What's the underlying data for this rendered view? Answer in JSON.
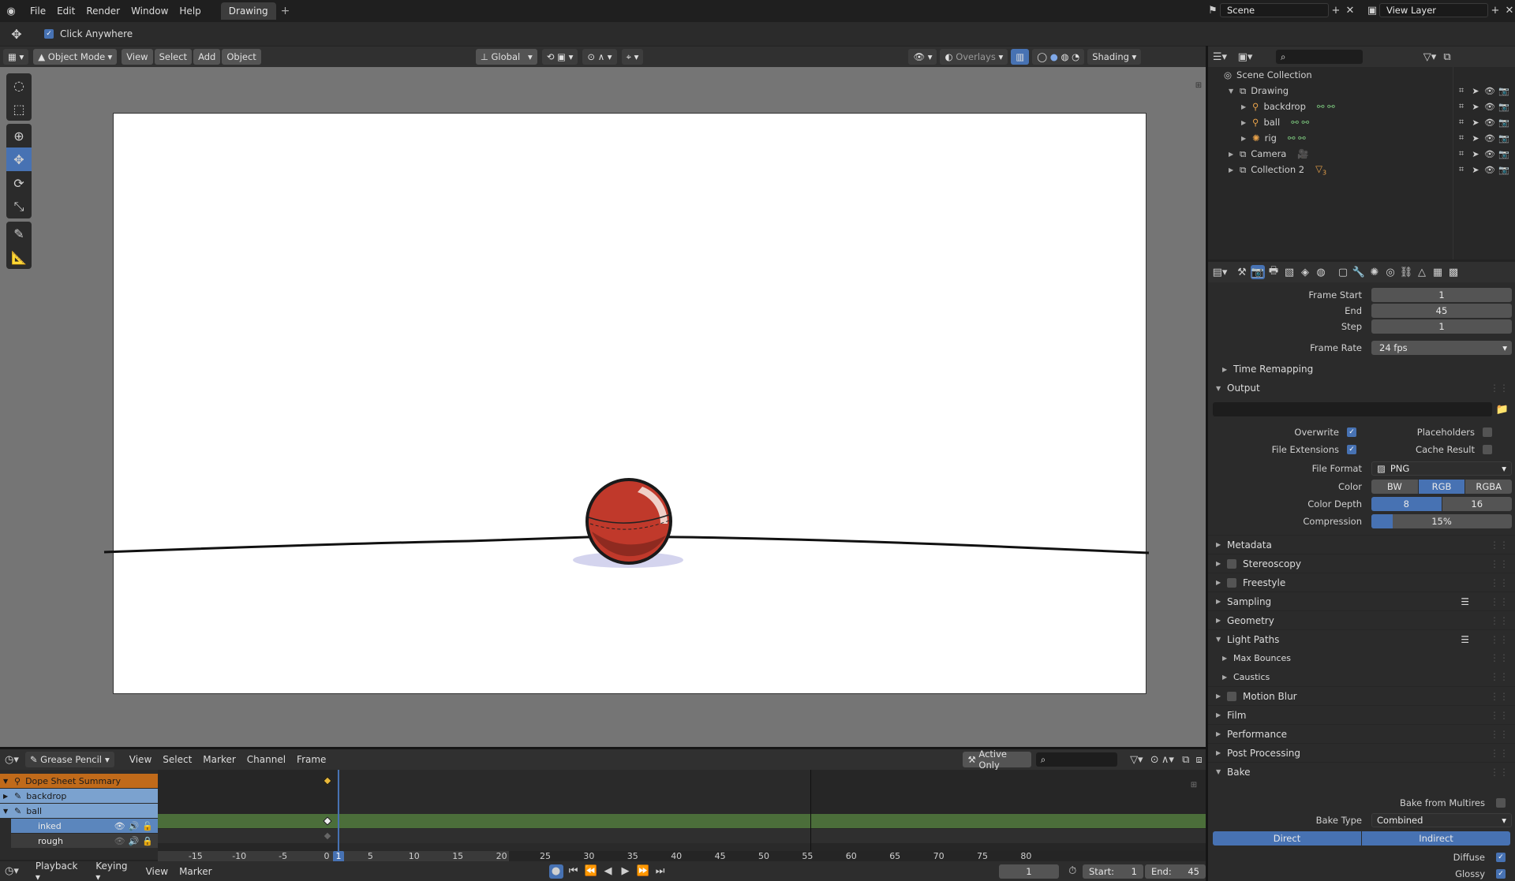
{
  "topbar": {
    "menus": [
      "File",
      "Edit",
      "Render",
      "Window",
      "Help"
    ],
    "workspace_tab": "Drawing",
    "add_tab": "+",
    "scene": "Scene",
    "view_layer": "View Layer"
  },
  "toolsettings": {
    "click_anywhere": "Click Anywhere"
  },
  "viewport_header": {
    "mode": "Object Mode",
    "menus": [
      "View",
      "Select",
      "Add",
      "Object"
    ],
    "orientation": "Global",
    "overlays": "Overlays",
    "shading": "Shading"
  },
  "outliner": {
    "scene_collection": "Scene Collection",
    "items": [
      {
        "label": "Drawing",
        "indent": 1
      },
      {
        "label": "backdrop",
        "indent": 2
      },
      {
        "label": "ball",
        "indent": 2
      },
      {
        "label": "rig",
        "indent": 2
      },
      {
        "label": "Camera",
        "indent": 1
      },
      {
        "label": "Collection 2",
        "indent": 1
      }
    ],
    "collection2_badge": "3"
  },
  "properties": {
    "frame_start_label": "Frame Start",
    "frame_start": "1",
    "end_label": "End",
    "end": "45",
    "step_label": "Step",
    "step": "1",
    "frame_rate_label": "Frame Rate",
    "frame_rate": "24 fps",
    "time_remapping": "Time Remapping",
    "output": "Output",
    "overwrite": "Overwrite",
    "placeholders": "Placeholders",
    "file_extensions": "File Extensions",
    "cache_result": "Cache Result",
    "file_format_label": "File Format",
    "file_format": "PNG",
    "color_label": "Color",
    "color_opts": [
      "BW",
      "RGB",
      "RGBA"
    ],
    "color_depth_label": "Color Depth",
    "depth_opts": [
      "8",
      "16"
    ],
    "compression_label": "Compression",
    "compression": "15%",
    "compression_fraction": 0.15,
    "panels": [
      "Metadata",
      "Stereoscopy",
      "Freestyle",
      "Sampling",
      "Geometry",
      "Light Paths",
      "Max Bounces",
      "Caustics",
      "Motion Blur",
      "Film",
      "Performance",
      "Post Processing",
      "Bake"
    ],
    "bake_from_multires": "Bake from Multires",
    "bake_type_label": "Bake Type",
    "bake_type": "Combined",
    "direct": "Direct",
    "indirect": "Indirect",
    "diffuse": "Diffuse",
    "glossy": "Glossy"
  },
  "dopesheet": {
    "editor": "Grease Pencil",
    "menus": [
      "View",
      "Select",
      "Marker",
      "Channel",
      "Frame"
    ],
    "active_only": "Active Only",
    "channels": {
      "summary": "Dope Sheet Summary",
      "backdrop": "backdrop",
      "ball": "ball",
      "inked": "inked",
      "rough": "rough"
    },
    "ticks": [
      "-15",
      "-10",
      "-5",
      "0",
      "5",
      "10",
      "15",
      "20",
      "25",
      "30",
      "35",
      "40",
      "45",
      "50",
      "55",
      "60",
      "65",
      "70",
      "75",
      "80"
    ],
    "current_frame": "1"
  },
  "timeline": {
    "menus": [
      "Playback",
      "Keying",
      "View",
      "Marker"
    ],
    "frame": "1",
    "start_label": "Start:",
    "start": "1",
    "end_label": "End:",
    "end": "45"
  },
  "colors": {
    "accent": "#4772b3",
    "ball": "#c0392b",
    "summary": "#c06a1a",
    "channel": "#7ba2cf"
  }
}
